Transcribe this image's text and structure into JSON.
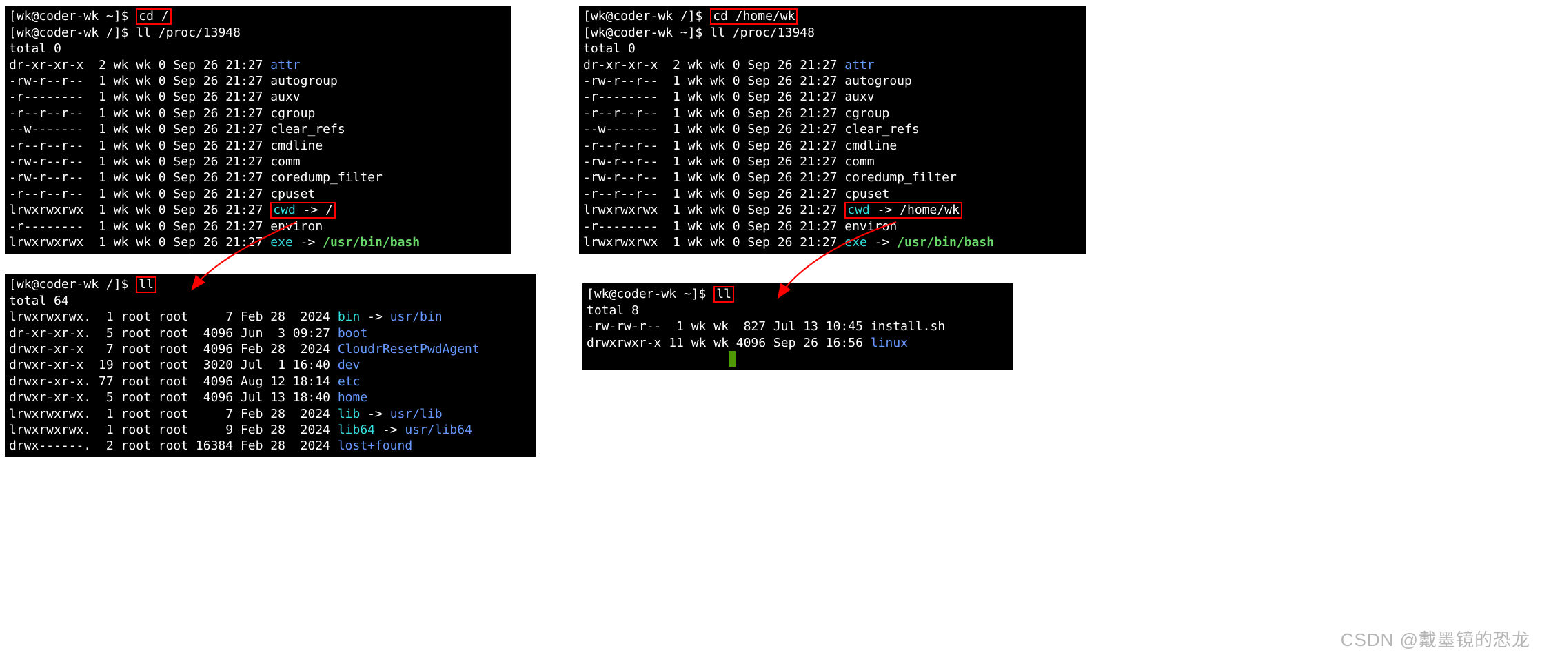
{
  "watermark": "CSDN @戴墨镜的恐龙",
  "left": {
    "top": {
      "prompt1_prefix": "[wk@coder-wk ~]$ ",
      "cmd1": "cd /",
      "prompt2_prefix": "[wk@coder-wk /]$ ",
      "cmd2": "ll /proc/13948",
      "total": "total 0",
      "rows": [
        {
          "perm": "dr-xr-xr-x",
          "n": "2",
          "u": "wk",
          "g": "wk",
          "sz": "0",
          "date": "Sep 26 21:27",
          "name": "attr",
          "cls": "blue",
          "link": ""
        },
        {
          "perm": "-rw-r--r--",
          "n": "1",
          "u": "wk",
          "g": "wk",
          "sz": "0",
          "date": "Sep 26 21:27",
          "name": "autogroup",
          "cls": "",
          "link": ""
        },
        {
          "perm": "-r--------",
          "n": "1",
          "u": "wk",
          "g": "wk",
          "sz": "0",
          "date": "Sep 26 21:27",
          "name": "auxv",
          "cls": "",
          "link": ""
        },
        {
          "perm": "-r--r--r--",
          "n": "1",
          "u": "wk",
          "g": "wk",
          "sz": "0",
          "date": "Sep 26 21:27",
          "name": "cgroup",
          "cls": "",
          "link": ""
        },
        {
          "perm": "--w-------",
          "n": "1",
          "u": "wk",
          "g": "wk",
          "sz": "0",
          "date": "Sep 26 21:27",
          "name": "clear_refs",
          "cls": "",
          "link": ""
        },
        {
          "perm": "-r--r--r--",
          "n": "1",
          "u": "wk",
          "g": "wk",
          "sz": "0",
          "date": "Sep 26 21:27",
          "name": "cmdline",
          "cls": "",
          "link": ""
        },
        {
          "perm": "-rw-r--r--",
          "n": "1",
          "u": "wk",
          "g": "wk",
          "sz": "0",
          "date": "Sep 26 21:27",
          "name": "comm",
          "cls": "",
          "link": ""
        },
        {
          "perm": "-rw-r--r--",
          "n": "1",
          "u": "wk",
          "g": "wk",
          "sz": "0",
          "date": "Sep 26 21:27",
          "name": "coredump_filter",
          "cls": "",
          "link": ""
        },
        {
          "perm": "-r--r--r--",
          "n": "1",
          "u": "wk",
          "g": "wk",
          "sz": "0",
          "date": "Sep 26 21:27",
          "name": "cpuset",
          "cls": "",
          "link": ""
        },
        {
          "perm": "lrwxrwxrwx",
          "n": "1",
          "u": "wk",
          "g": "wk",
          "sz": "0",
          "date": "Sep 26 21:27",
          "name": "cwd",
          "cls": "cyan",
          "link": " -> /",
          "boxed": true
        },
        {
          "perm": "-r--------",
          "n": "1",
          "u": "wk",
          "g": "wk",
          "sz": "0",
          "date": "Sep 26 21:27",
          "name": "environ",
          "cls": "",
          "link": ""
        },
        {
          "perm": "lrwxrwxrwx",
          "n": "1",
          "u": "wk",
          "g": "wk",
          "sz": "0",
          "date": "Sep 26 21:27",
          "name": "exe",
          "cls": "cyan",
          "link": " -> /usr/bin/bash",
          "link_cls": "green"
        }
      ]
    },
    "bottom": {
      "prompt_prefix": "[wk@coder-wk /]$ ",
      "cmd": "ll",
      "total": "total 64",
      "rows": [
        {
          "perm": "lrwxrwxrwx.",
          "n": " 1",
          "u": "root",
          "g": "root",
          "sz": "    7",
          "date": "Feb 28  2024",
          "name": "bin",
          "cls": "cyan",
          "link": " -> usr/bin",
          "link_cls": "blue"
        },
        {
          "perm": "dr-xr-xr-x.",
          "n": " 5",
          "u": "root",
          "g": "root",
          "sz": " 4096",
          "date": "Jun  3 09:27",
          "name": "boot",
          "cls": "blue",
          "link": ""
        },
        {
          "perm": "drwxr-xr-x ",
          "n": " 7",
          "u": "root",
          "g": "root",
          "sz": " 4096",
          "date": "Feb 28  2024",
          "name": "CloudrResetPwdAgent",
          "cls": "blue",
          "link": ""
        },
        {
          "perm": "drwxr-xr-x ",
          "n": "19",
          "u": "root",
          "g": "root",
          "sz": " 3020",
          "date": "Jul  1 16:40",
          "name": "dev",
          "cls": "blue",
          "link": ""
        },
        {
          "perm": "drwxr-xr-x.",
          "n": "77",
          "u": "root",
          "g": "root",
          "sz": " 4096",
          "date": "Aug 12 18:14",
          "name": "etc",
          "cls": "blue",
          "link": ""
        },
        {
          "perm": "drwxr-xr-x.",
          "n": " 5",
          "u": "root",
          "g": "root",
          "sz": " 4096",
          "date": "Jul 13 18:40",
          "name": "home",
          "cls": "blue",
          "link": ""
        },
        {
          "perm": "lrwxrwxrwx.",
          "n": " 1",
          "u": "root",
          "g": "root",
          "sz": "    7",
          "date": "Feb 28  2024",
          "name": "lib",
          "cls": "cyan",
          "link": " -> usr/lib",
          "link_cls": "blue"
        },
        {
          "perm": "lrwxrwxrwx.",
          "n": " 1",
          "u": "root",
          "g": "root",
          "sz": "    9",
          "date": "Feb 28  2024",
          "name": "lib64",
          "cls": "cyan",
          "link": " -> usr/lib64",
          "link_cls": "blue"
        },
        {
          "perm": "drwx------.",
          "n": " 2",
          "u": "root",
          "g": "root",
          "sz": "16384",
          "date": "Feb 28  2024",
          "name": "lost+found",
          "cls": "blue",
          "link": ""
        }
      ]
    }
  },
  "right": {
    "top": {
      "prompt1_prefix": "[wk@coder-wk /]$ ",
      "cmd1": "cd /home/wk",
      "prompt2_prefix": "[wk@coder-wk ~]$ ",
      "cmd2": "ll /proc/13948",
      "total": "total 0",
      "rows": [
        {
          "perm": "dr-xr-xr-x",
          "n": "2",
          "u": "wk",
          "g": "wk",
          "sz": "0",
          "date": "Sep 26 21:27",
          "name": "attr",
          "cls": "blue",
          "link": ""
        },
        {
          "perm": "-rw-r--r--",
          "n": "1",
          "u": "wk",
          "g": "wk",
          "sz": "0",
          "date": "Sep 26 21:27",
          "name": "autogroup",
          "cls": "",
          "link": ""
        },
        {
          "perm": "-r--------",
          "n": "1",
          "u": "wk",
          "g": "wk",
          "sz": "0",
          "date": "Sep 26 21:27",
          "name": "auxv",
          "cls": "",
          "link": ""
        },
        {
          "perm": "-r--r--r--",
          "n": "1",
          "u": "wk",
          "g": "wk",
          "sz": "0",
          "date": "Sep 26 21:27",
          "name": "cgroup",
          "cls": "",
          "link": ""
        },
        {
          "perm": "--w-------",
          "n": "1",
          "u": "wk",
          "g": "wk",
          "sz": "0",
          "date": "Sep 26 21:27",
          "name": "clear_refs",
          "cls": "",
          "link": ""
        },
        {
          "perm": "-r--r--r--",
          "n": "1",
          "u": "wk",
          "g": "wk",
          "sz": "0",
          "date": "Sep 26 21:27",
          "name": "cmdline",
          "cls": "",
          "link": ""
        },
        {
          "perm": "-rw-r--r--",
          "n": "1",
          "u": "wk",
          "g": "wk",
          "sz": "0",
          "date": "Sep 26 21:27",
          "name": "comm",
          "cls": "",
          "link": ""
        },
        {
          "perm": "-rw-r--r--",
          "n": "1",
          "u": "wk",
          "g": "wk",
          "sz": "0",
          "date": "Sep 26 21:27",
          "name": "coredump_filter",
          "cls": "",
          "link": ""
        },
        {
          "perm": "-r--r--r--",
          "n": "1",
          "u": "wk",
          "g": "wk",
          "sz": "0",
          "date": "Sep 26 21:27",
          "name": "cpuset",
          "cls": "",
          "link": ""
        },
        {
          "perm": "lrwxrwxrwx",
          "n": "1",
          "u": "wk",
          "g": "wk",
          "sz": "0",
          "date": "Sep 26 21:27",
          "name": "cwd",
          "cls": "cyan",
          "link": " -> /home/wk",
          "boxed": true
        },
        {
          "perm": "-r--------",
          "n": "1",
          "u": "wk",
          "g": "wk",
          "sz": "0",
          "date": "Sep 26 21:27",
          "name": "environ",
          "cls": "",
          "link": ""
        },
        {
          "perm": "lrwxrwxrwx",
          "n": "1",
          "u": "wk",
          "g": "wk",
          "sz": "0",
          "date": "Sep 26 21:27",
          "name": "exe",
          "cls": "cyan",
          "link": " -> /usr/bin/bash",
          "link_cls": "green"
        }
      ]
    },
    "bottom": {
      "prompt_prefix": "[wk@coder-wk ~]$ ",
      "cmd": "ll",
      "total": "total 8",
      "rows": [
        {
          "perm": "-rw-rw-r--",
          "n": " 1",
          "u": "wk",
          "g": "wk",
          "sz": " 827",
          "date": "Jul 13 10:45",
          "name": "install.sh",
          "cls": "",
          "link": ""
        },
        {
          "perm": "drwxrwxr-x",
          "n": "11",
          "u": "wk",
          "g": "wk",
          "sz": "4096",
          "date": "Sep 26 16:56",
          "name": "linux",
          "cls": "blue",
          "link": ""
        }
      ]
    }
  }
}
